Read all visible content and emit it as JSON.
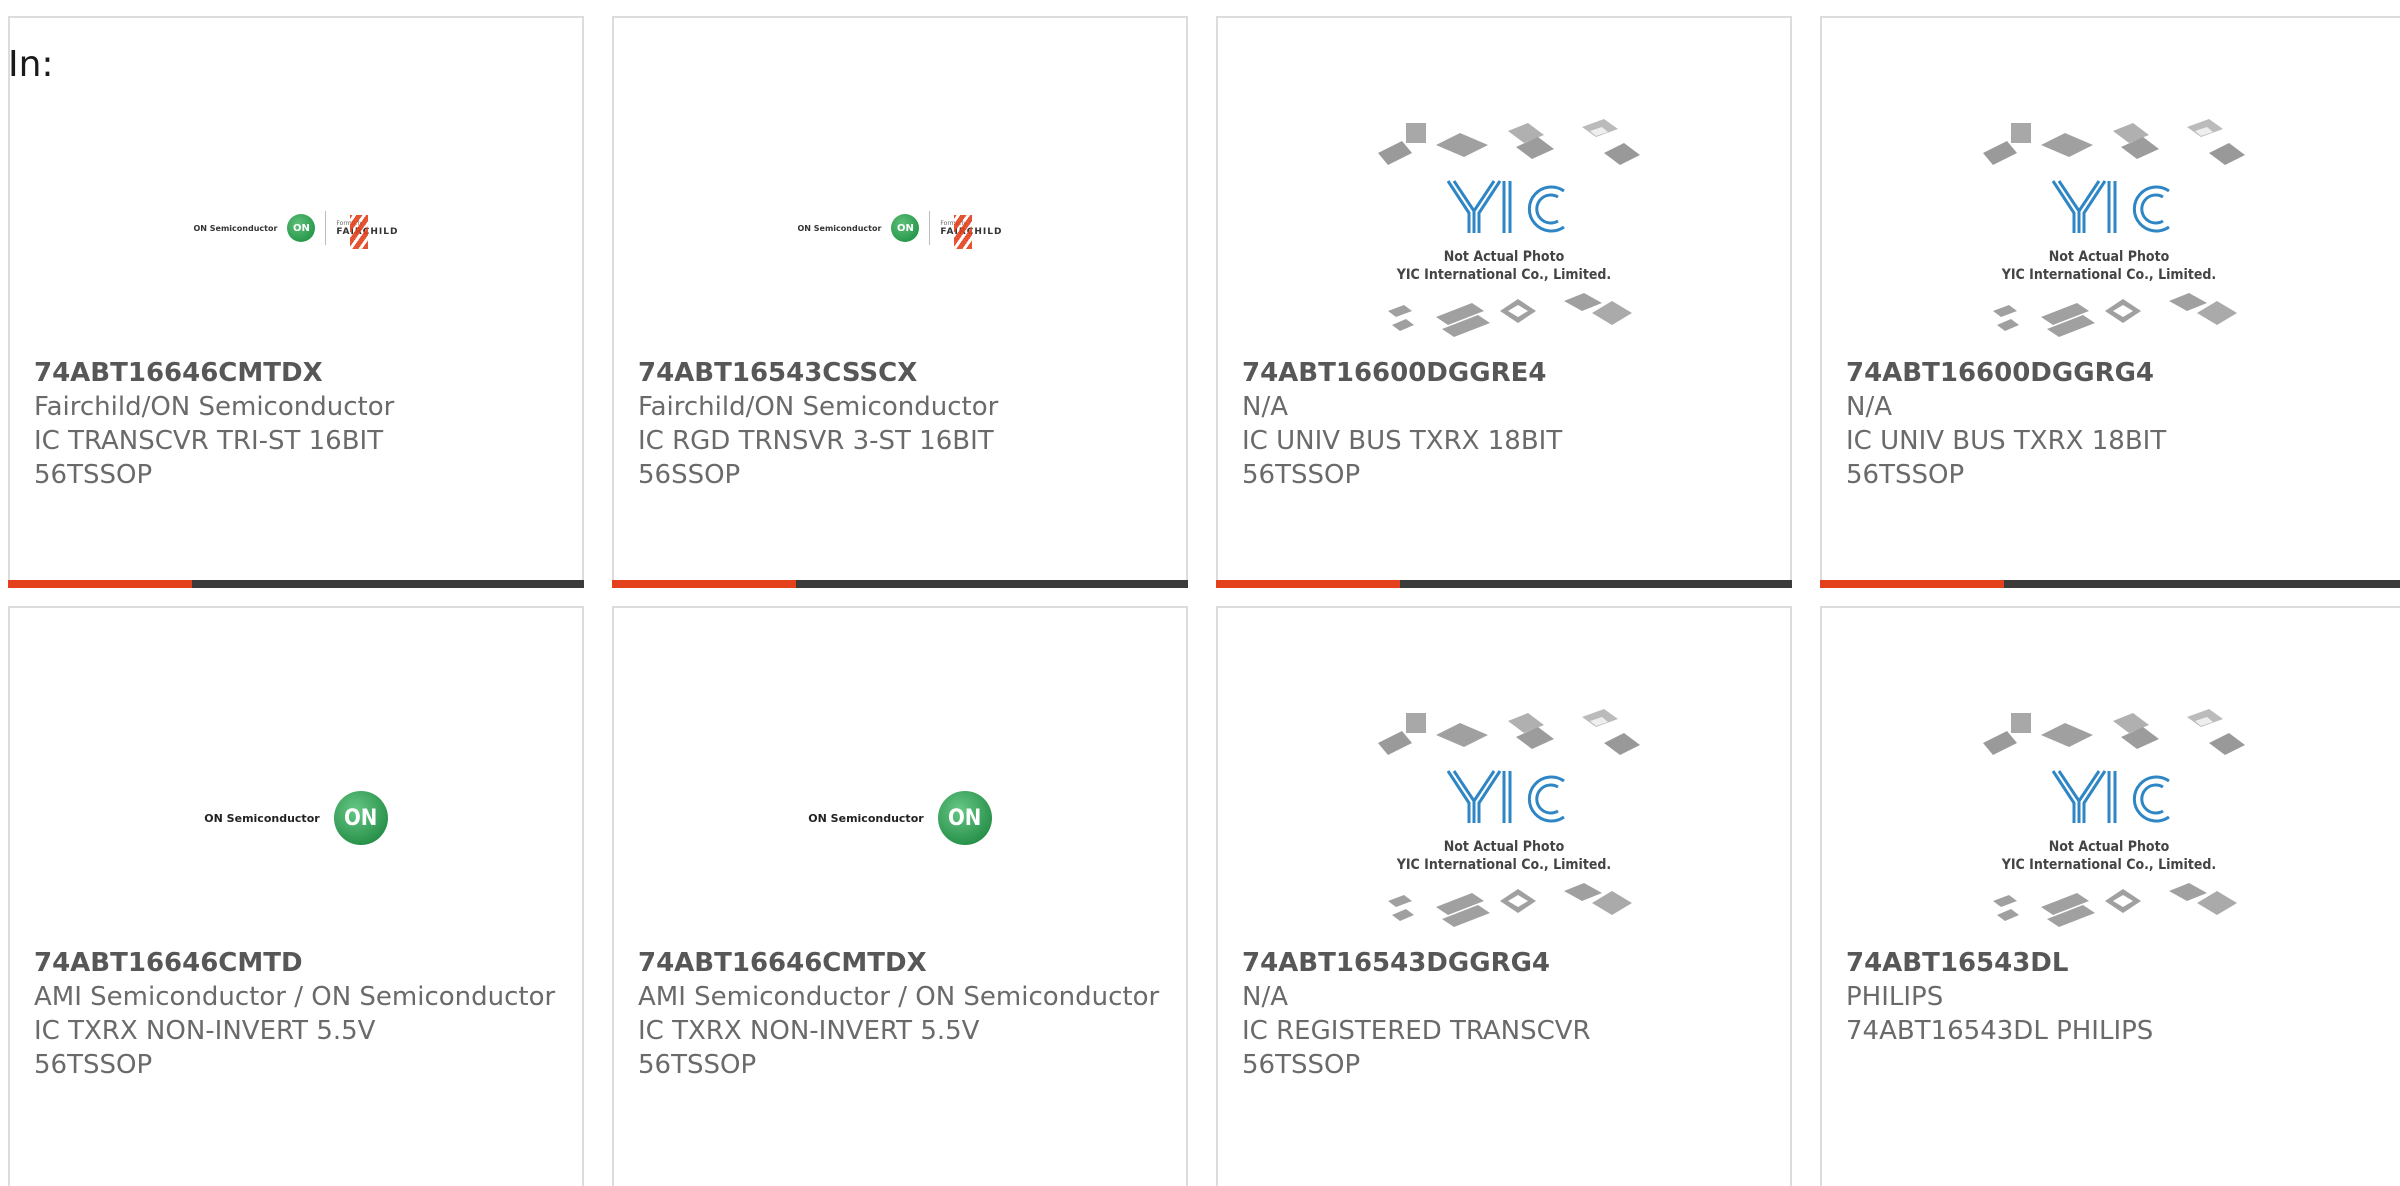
{
  "page": {
    "filter_label": "In:"
  },
  "placeholder_image": {
    "brand": "YIC",
    "caption_line1": "Not Actual Photo",
    "caption_line2": "YIC International Co., Limited."
  },
  "logos": {
    "on_semi": "ON Semiconductor",
    "on_badge": "ON",
    "formerly": "Formerly",
    "fairchild": "FAIRCHILD"
  },
  "colors": {
    "accent": "#e3401c",
    "bar": "#3b3b3b",
    "on_green": "#138a3a"
  },
  "products": [
    {
      "part": "74ABT16646CMTDX",
      "maker": "Fairchild/ON Semiconductor",
      "desc": "IC TRANSCVR TRI-ST 16BIT",
      "pkg": "56TSSOP",
      "image": "fairchild-on-logo"
    },
    {
      "part": "74ABT16543CSSCX",
      "maker": "Fairchild/ON Semiconductor",
      "desc": "IC RGD TRNSVR 3-ST 16BIT",
      "pkg": "56SSOP",
      "image": "fairchild-on-logo"
    },
    {
      "part": "74ABT16600DGGRE4",
      "maker": "N/A",
      "desc": "IC UNIV BUS TXRX 18BIT",
      "pkg": "56TSSOP",
      "image": "yic-placeholder"
    },
    {
      "part": "74ABT16600DGGRG4",
      "maker": "N/A",
      "desc": "IC UNIV BUS TXRX 18BIT",
      "pkg": "56TSSOP",
      "image": "yic-placeholder"
    },
    {
      "part": "74ABT16646CMTD",
      "maker": "AMI Semiconductor / ON Semiconductor",
      "desc": "IC TXRX NON-INVERT 5.5V",
      "pkg": "56TSSOP",
      "image": "on-semi-logo"
    },
    {
      "part": "74ABT16646CMTDX",
      "maker": "AMI Semiconductor / ON Semiconductor",
      "desc": "IC TXRX NON-INVERT 5.5V",
      "pkg": "56TSSOP",
      "image": "on-semi-logo"
    },
    {
      "part": "74ABT16543DGGRG4",
      "maker": "N/A",
      "desc": "IC REGISTERED TRANSCVR",
      "pkg": "56TSSOP",
      "image": "yic-placeholder"
    },
    {
      "part": "74ABT16543DL",
      "maker": "PHILIPS",
      "desc": "74ABT16543DL PHILIPS",
      "pkg": "",
      "image": "yic-placeholder"
    }
  ]
}
